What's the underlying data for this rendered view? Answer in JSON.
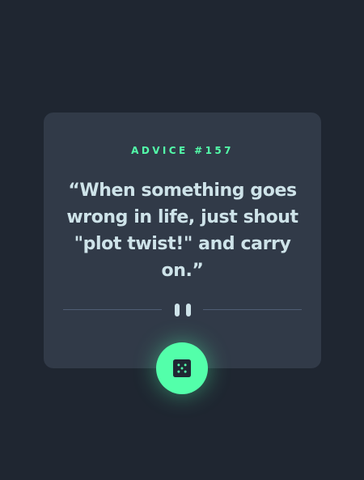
{
  "card": {
    "advice_label": "ADVICE #157",
    "quote": "“When something goes wrong in life, just shout \"plot twist!\" and carry on.”"
  },
  "icons": {
    "divider": "pause-icon",
    "button": "dice-icon"
  },
  "colors": {
    "background": "#1f2631",
    "card": "#313a48",
    "accent": "#53ffaa",
    "text": "#cee3e9",
    "divider": "#4f5d74"
  }
}
